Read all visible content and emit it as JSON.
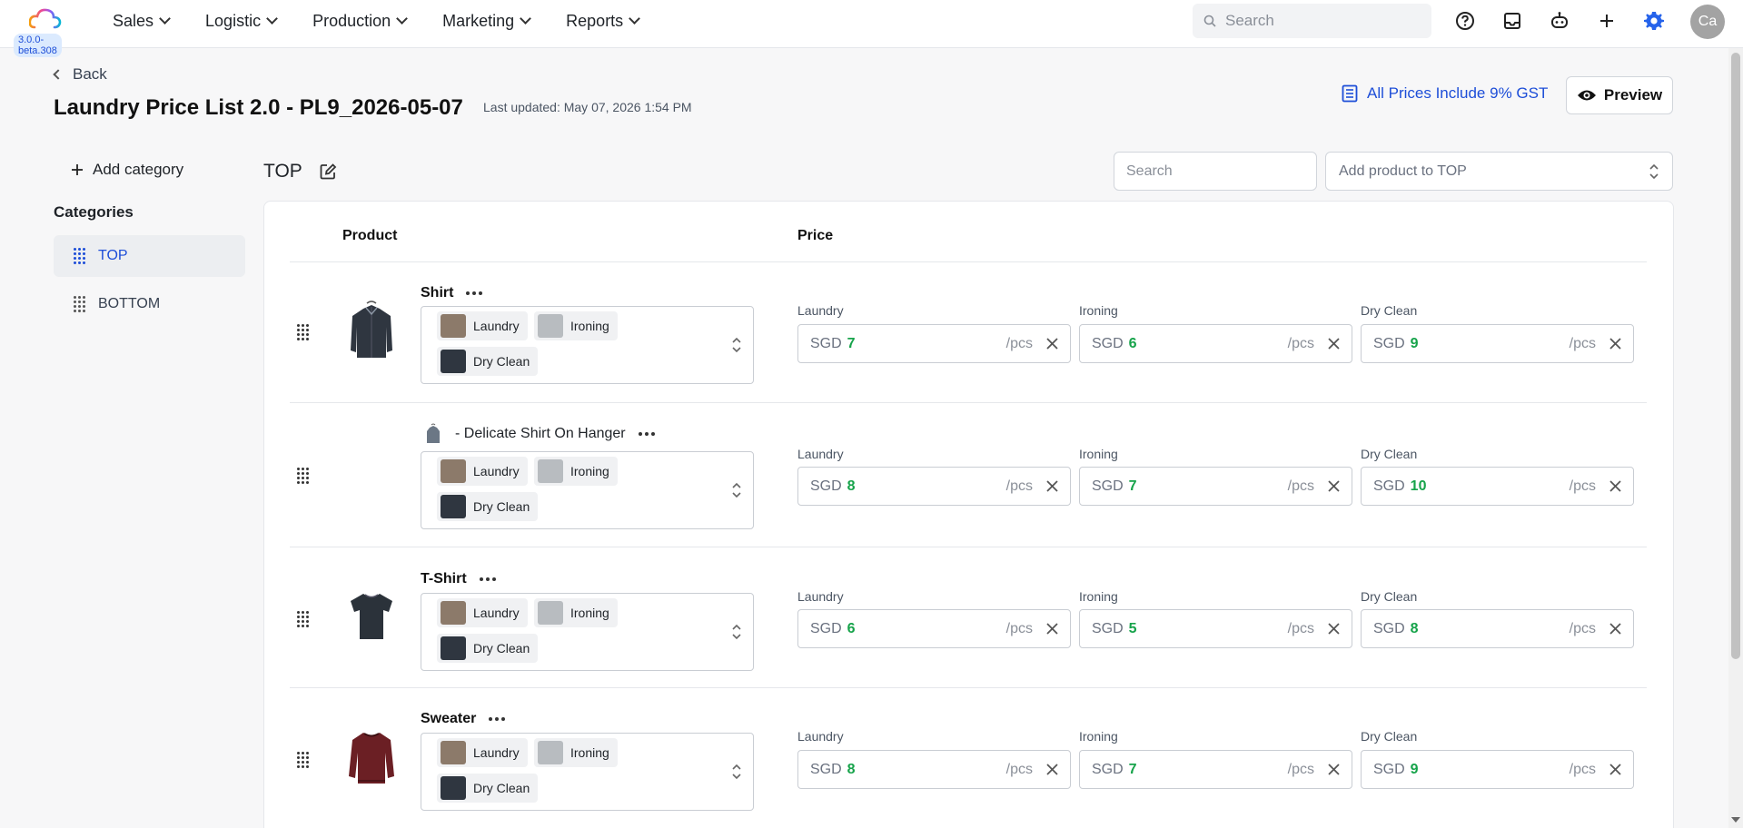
{
  "app": {
    "version": "3.0.0-beta.308"
  },
  "nav": [
    {
      "label": "Sales"
    },
    {
      "label": "Logistic"
    },
    {
      "label": "Production"
    },
    {
      "label": "Marketing"
    },
    {
      "label": "Reports"
    }
  ],
  "topbar": {
    "search_placeholder": "Search",
    "avatar": "Ca"
  },
  "header": {
    "back": "Back",
    "title": "Laundry Price List 2.0 - PL9_2026-05-07",
    "updated": "Last updated: May 07, 2026 1:54 PM",
    "gst": "All Prices Include 9% GST",
    "preview": "Preview"
  },
  "sidebar": {
    "add_category": "Add category",
    "title": "Categories",
    "items": [
      {
        "label": "TOP"
      },
      {
        "label": "BOTTOM"
      }
    ]
  },
  "section": {
    "title": "TOP",
    "search_placeholder": "Search",
    "add_product_placeholder": "Add product to TOP"
  },
  "table": {
    "headers": {
      "product": "Product",
      "price": "Price"
    },
    "rows": [
      {
        "name": "Shirt",
        "services": [
          "Laundry",
          "Ironing",
          "Dry Clean"
        ],
        "prices": [
          {
            "label": "Laundry",
            "currency": "SGD",
            "value": "7",
            "unit": "/pcs"
          },
          {
            "label": "Ironing",
            "currency": "SGD",
            "value": "6",
            "unit": "/pcs"
          },
          {
            "label": "Dry Clean",
            "currency": "SGD",
            "value": "9",
            "unit": "/pcs"
          }
        ]
      },
      {
        "name": "- Delicate Shirt On Hanger",
        "services": [
          "Laundry",
          "Ironing",
          "Dry Clean"
        ],
        "prices": [
          {
            "label": "Laundry",
            "currency": "SGD",
            "value": "8",
            "unit": "/pcs"
          },
          {
            "label": "Ironing",
            "currency": "SGD",
            "value": "7",
            "unit": "/pcs"
          },
          {
            "label": "Dry Clean",
            "currency": "SGD",
            "value": "10",
            "unit": "/pcs"
          }
        ]
      },
      {
        "name": "T-Shirt",
        "services": [
          "Laundry",
          "Ironing",
          "Dry Clean"
        ],
        "prices": [
          {
            "label": "Laundry",
            "currency": "SGD",
            "value": "6",
            "unit": "/pcs"
          },
          {
            "label": "Ironing",
            "currency": "SGD",
            "value": "5",
            "unit": "/pcs"
          },
          {
            "label": "Dry Clean",
            "currency": "SGD",
            "value": "8",
            "unit": "/pcs"
          }
        ]
      },
      {
        "name": "Sweater",
        "services": [
          "Laundry",
          "Ironing",
          "Dry Clean"
        ],
        "prices": [
          {
            "label": "Laundry",
            "currency": "SGD",
            "value": "8",
            "unit": "/pcs"
          },
          {
            "label": "Ironing",
            "currency": "SGD",
            "value": "7",
            "unit": "/pcs"
          },
          {
            "label": "Dry Clean",
            "currency": "SGD",
            "value": "9",
            "unit": "/pcs"
          }
        ]
      }
    ]
  },
  "colors": {
    "accent": "#1d4ed8",
    "price_value": "#16a34a",
    "gear": "#2563eb"
  }
}
